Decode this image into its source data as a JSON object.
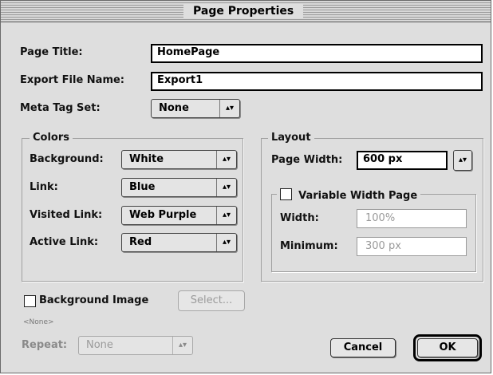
{
  "window": {
    "title": "Page Properties"
  },
  "page_title": {
    "label": "Page Title:",
    "value": "HomePage"
  },
  "export_file_name": {
    "label": "Export File Name:",
    "value": "Export1"
  },
  "meta_tag_set": {
    "label": "Meta Tag Set:",
    "selected": "None"
  },
  "colors": {
    "group_title": "Colors",
    "background": {
      "label": "Background:",
      "selected": "White"
    },
    "link": {
      "label": "Link:",
      "selected": "Blue"
    },
    "visited_link": {
      "label": "Visited Link:",
      "selected": "Web Purple"
    },
    "active_link": {
      "label": "Active Link:",
      "selected": "Red"
    }
  },
  "layout": {
    "group_title": "Layout",
    "page_width": {
      "label": "Page Width:",
      "value": "600  px"
    },
    "variable_width_page": {
      "label": "Variable Width Page",
      "checked": false,
      "width": {
        "label": "Width:",
        "value": "100%"
      },
      "minimum": {
        "label": "Minimum:",
        "value": "300  px"
      }
    }
  },
  "background_image": {
    "label": "Background Image",
    "checked": false,
    "select_label": "Select...",
    "file_note": "<None>",
    "repeat": {
      "label": "Repeat:",
      "selected": "None"
    }
  },
  "buttons": {
    "cancel": "Cancel",
    "ok": "OK"
  },
  "icons": {
    "popup_arrows": "⇕",
    "popup_arrows_glyph": "▴▾",
    "stepper_glyph": "▴▾"
  }
}
